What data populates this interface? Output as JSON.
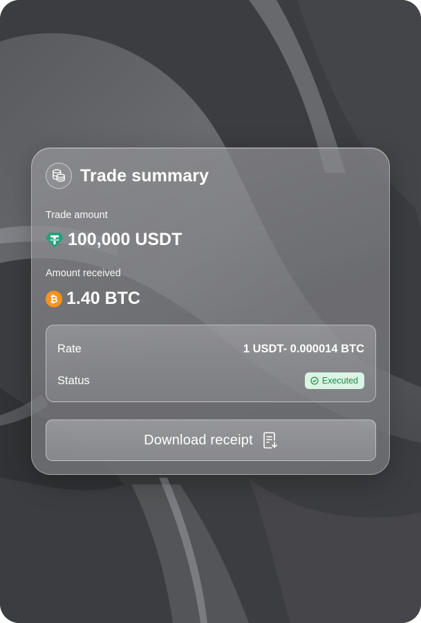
{
  "card": {
    "title": "Trade summary",
    "icon": "coins-icon",
    "trade_amount": {
      "label": "Trade amount",
      "value": "100,000 USDT",
      "icon": "tether-icon",
      "icon_color": "#26a17b"
    },
    "amount_received": {
      "label": "Amount received",
      "value": "1.40 BTC",
      "icon": "bitcoin-icon",
      "icon_color": "#f7931a"
    },
    "details": {
      "rate_label": "Rate",
      "rate_value": "1 USDT- 0.000014 BTC",
      "status_label": "Status",
      "status_value": "Executed",
      "status_color": "#1f8a4c",
      "status_bg": "#d9f5e4"
    },
    "download": {
      "label": "Download receipt",
      "icon": "receipt-download-icon"
    }
  }
}
